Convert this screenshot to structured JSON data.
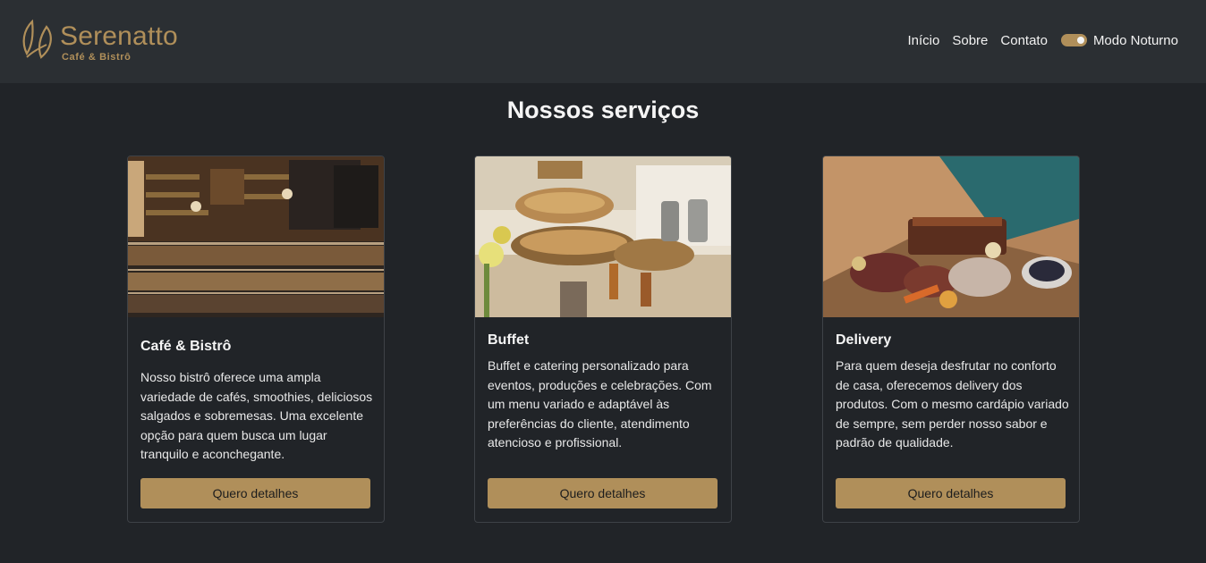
{
  "brand": {
    "name": "Serenatto",
    "tagline": "Café & Bistrô",
    "color": "#b08f5a"
  },
  "nav": {
    "items": [
      "Início",
      "Sobre",
      "Contato"
    ],
    "dark_mode_label": "Modo Noturno",
    "dark_mode_on": true
  },
  "section": {
    "title": "Nossos serviços"
  },
  "cards": [
    {
      "title": "Café & Bistrô",
      "description": "Nosso bistrô oferece uma ampla variedade de cafés, smoothies, deliciosos salgados e sobremesas. Uma excelente opção para quem busca um lugar tranquilo e aconchegante.",
      "button": "Quero detalhes",
      "image_icon": "cafe-counter-photo"
    },
    {
      "title": "Buffet",
      "description": "Buffet e catering personalizado para eventos, produções e celebrações. Com um menu variado e adaptável às preferências do cliente, atendimento atencioso e profissional.",
      "button": "Quero detalhes",
      "image_icon": "buffet-table-photo"
    },
    {
      "title": "Delivery",
      "description": "Para quem deseja desfrutar no conforto de casa, oferecemos delivery dos produtos. Com o mesmo cardápio variado de sempre, sem perder nosso sabor e padrão de qualidade.",
      "button": "Quero detalhes",
      "image_icon": "delivery-box-photo"
    }
  ],
  "colors": {
    "background": "#212428",
    "header": "#2b2f33",
    "accent": "#b08f5a"
  }
}
